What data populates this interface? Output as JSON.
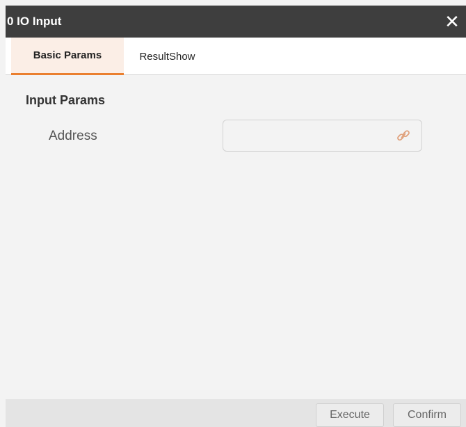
{
  "window": {
    "title": "0 IO Input",
    "close_symbol": "✕"
  },
  "tabs": [
    {
      "label": "Basic Params",
      "active": true
    },
    {
      "label": "ResultShow",
      "active": false
    }
  ],
  "section": {
    "title": "Input Params"
  },
  "fields": {
    "address": {
      "label": "Address",
      "value": "",
      "icon": "link-icon"
    }
  },
  "footer": {
    "execute_label": "Execute",
    "confirm_label": "Confirm"
  },
  "colors": {
    "titlebar": "#3e3e3e",
    "accent": "#ea7f2f",
    "active_tab_bg": "#fbeee6",
    "content_bg": "#f3f3f3"
  }
}
